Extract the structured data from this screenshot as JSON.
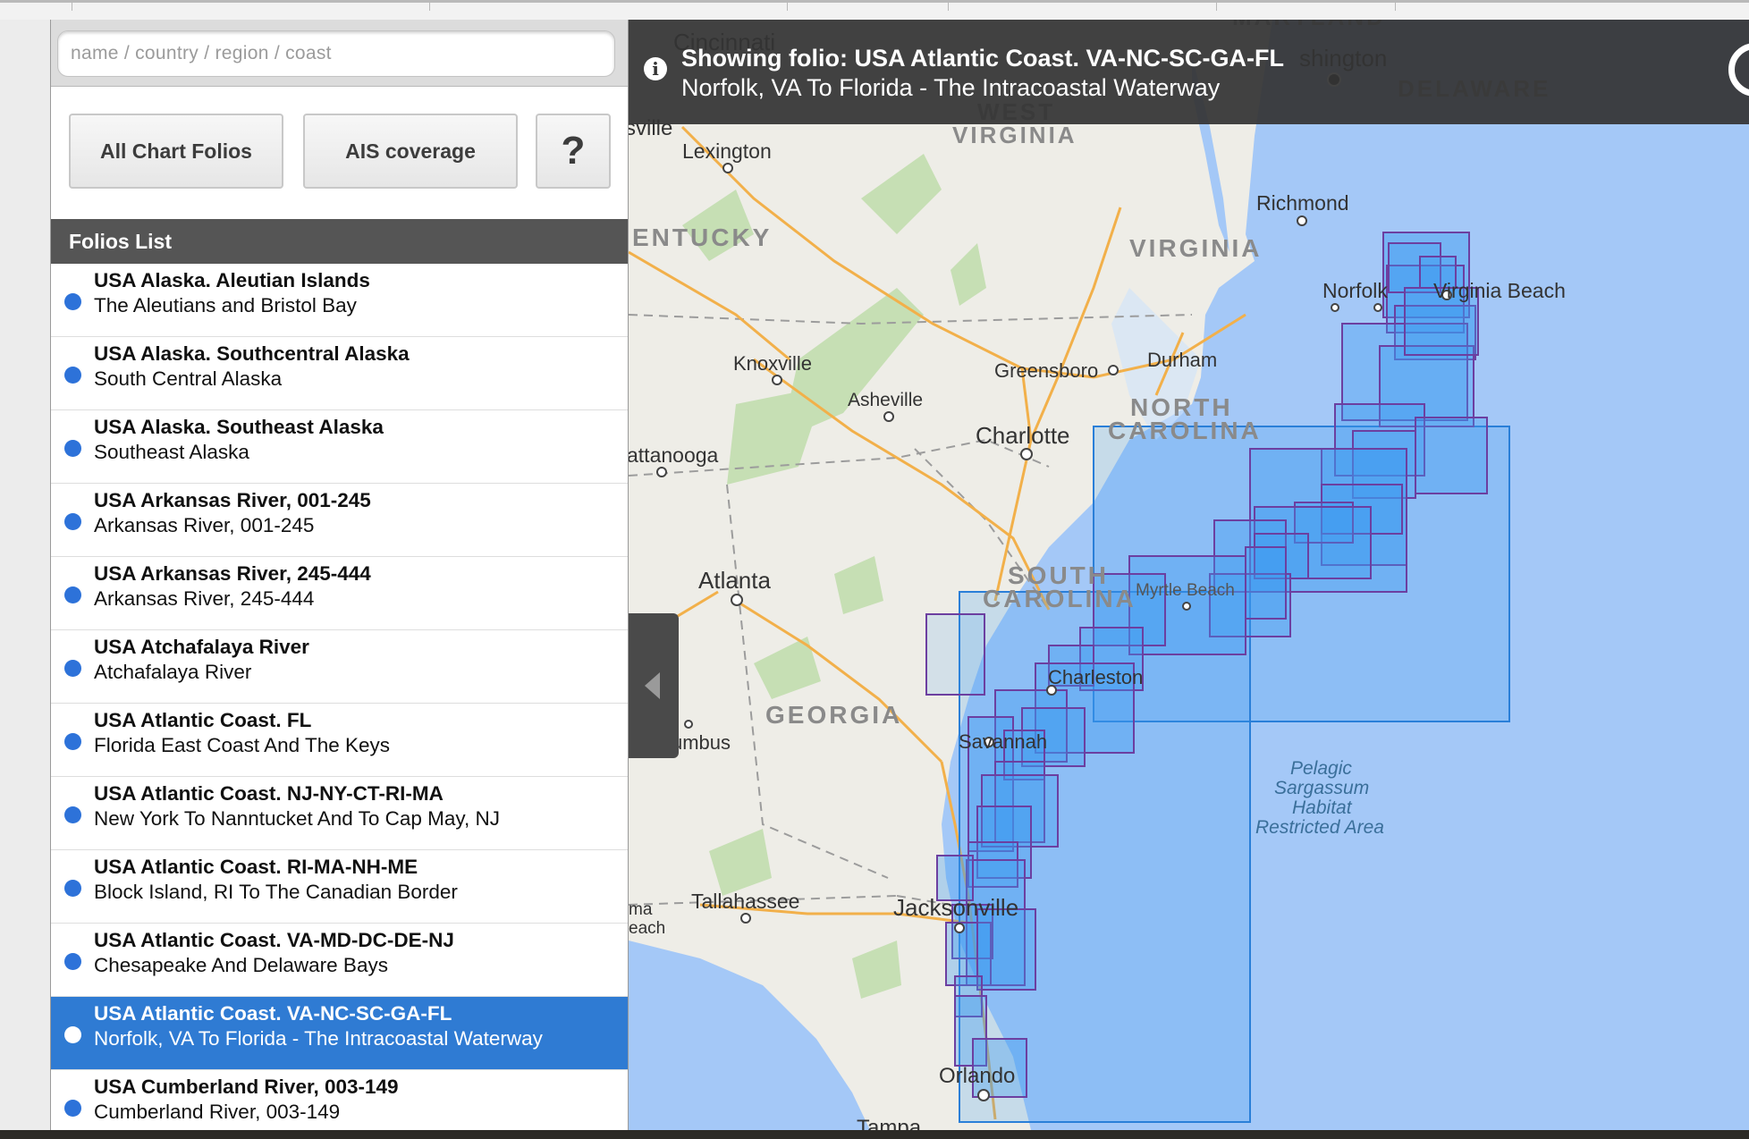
{
  "search": {
    "placeholder": "name / country / region / coast"
  },
  "buttons": {
    "all_folios": "All Chart Folios",
    "ais": "AIS coverage",
    "help": "?"
  },
  "list_header": "Folios List",
  "folios": [
    {
      "title": "USA Alaska. Aleutian Islands",
      "subtitle": "The Aleutians and Bristol Bay"
    },
    {
      "title": "USA Alaska. Southcentral Alaska",
      "subtitle": "South Central Alaska"
    },
    {
      "title": "USA Alaska. Southeast Alaska",
      "subtitle": "Southeast Alaska"
    },
    {
      "title": "USA Arkansas River, 001-245",
      "subtitle": "Arkansas River, 001-245"
    },
    {
      "title": "USA Arkansas River, 245-444",
      "subtitle": "Arkansas River, 245-444"
    },
    {
      "title": "USA Atchafalaya River",
      "subtitle": "Atchafalaya River"
    },
    {
      "title": "USA Atlantic Coast. FL",
      "subtitle": "Florida East Coast And The Keys"
    },
    {
      "title": "USA Atlantic Coast. NJ-NY-CT-RI-MA",
      "subtitle": "New York To Nanntucket And To Cap May, NJ"
    },
    {
      "title": "USA Atlantic Coast. RI-MA-NH-ME",
      "subtitle": "Block Island, RI To The Canadian Border"
    },
    {
      "title": "USA Atlantic Coast. VA-MD-DC-DE-NJ",
      "subtitle": "Chesapeake And Delaware Bays"
    },
    {
      "title": "USA Atlantic Coast. VA-NC-SC-GA-FL",
      "subtitle": "Norfolk, VA To Florida - The Intracoastal Waterway",
      "selected": true
    },
    {
      "title": "USA Cumberland River, 003-149",
      "subtitle": "Cumberland River, 003-149"
    }
  ],
  "banner": {
    "title": "Showing folio: USA Atlantic Coast. VA-NC-SC-GA-FL",
    "subtitle": "Norfolk, VA To Florida - The Intracoastal Waterway"
  },
  "map": {
    "cities": {
      "cincinnati": "Cincinnati",
      "washington": "shington",
      "lexington": "Lexington",
      "richmond": "Richmond",
      "norfolk": "Norfolk",
      "virginia_beach": "Virginia Beach",
      "knoxville": "Knoxville",
      "greensboro": "Greensboro",
      "durham": "Durham",
      "asheville": "Asheville",
      "charlotte": "Charlotte",
      "chattanooga": "attanooga",
      "atlanta": "Atlanta",
      "myrtle_beach": "Myrtle Beach",
      "charleston": "Charleston",
      "columbus": "umbus",
      "savannah": "Savannah",
      "tallahassee": "Tallahassee",
      "jacksonville": "Jacksonville",
      "orlando": "Orlando",
      "tampa": "Tampa",
      "panama_city_1": "ma",
      "panama_city_2": "each",
      "louisville": "sville"
    },
    "states": {
      "maryland": "MARYLAND",
      "delaware": "DELAWARE",
      "west": "WEST",
      "west_virginia": "VIRGINIA",
      "kentucky": "ENTUCKY",
      "virginia": "VIRGINIA",
      "north": "NORTH",
      "north_carolina": "CAROLINA",
      "south": "SOUTH",
      "south_carolina": "CAROLINA",
      "georgia": "GEORGIA"
    },
    "sea_area": [
      "Pelagic",
      "Sargassum",
      "Habitat",
      "Restricted Area"
    ]
  },
  "colors": {
    "selected_row": "#2f7bd3",
    "dot": "#2d72d9",
    "sea": "#a4c8f7",
    "land": "#eeede7",
    "chart_fill": "#3c9cf0",
    "chart_border_dark": "#6c3fa0",
    "chart_border_light": "#2a7fd8"
  }
}
